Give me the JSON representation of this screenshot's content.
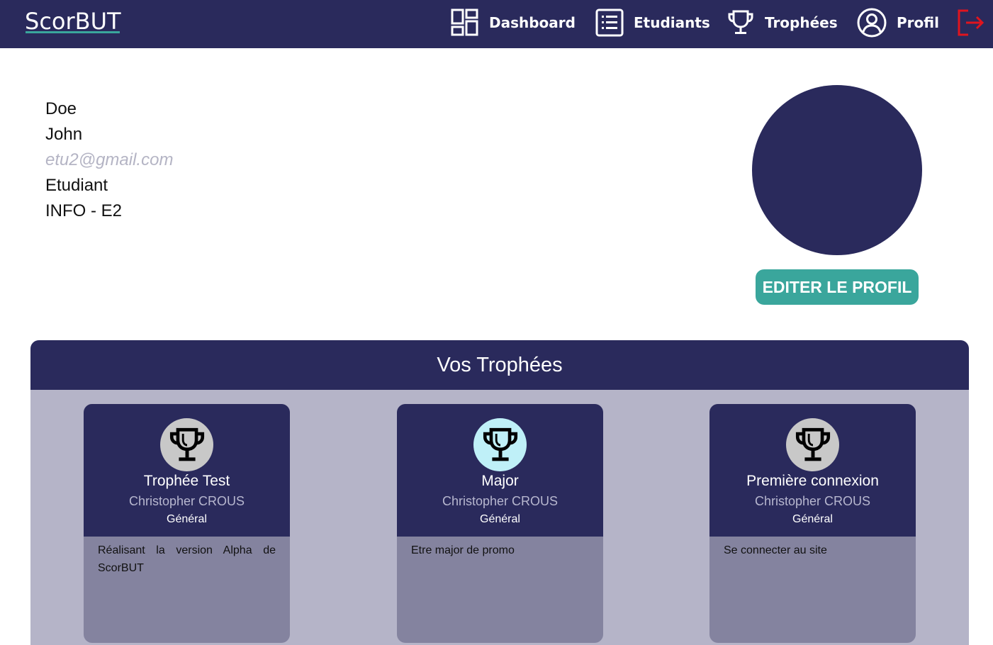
{
  "app": {
    "brand": "ScorBUT",
    "accent": "#3aa69c",
    "primary": "#2a2a5c",
    "logout_color": "#e0141e"
  },
  "nav": {
    "items": [
      {
        "label": "Dashboard",
        "icon": "grid-icon"
      },
      {
        "label": "Etudiants",
        "icon": "list-icon"
      },
      {
        "label": "Trophées",
        "icon": "trophy-icon"
      },
      {
        "label": "Profil",
        "icon": "user-circle-icon"
      }
    ],
    "logout_icon": "logout-icon"
  },
  "profile": {
    "last_name": "Doe",
    "first_name": "John",
    "email": "etu2@gmail.com",
    "role": "Etudiant",
    "group": "INFO - E2",
    "edit_label": "EDITER LE PROFIL"
  },
  "trophies": {
    "title": "Vos Trophées",
    "cards": [
      {
        "title": "Trophée Test",
        "author": "Christopher CROUS",
        "category": "Général",
        "description": "Réalisant la version Alpha de ScorBUT",
        "badge_color": "#c8c8c8"
      },
      {
        "title": "Major",
        "author": "Christopher CROUS",
        "category": "Général",
        "description": "Etre major de promo",
        "badge_color": "#bff0f8"
      },
      {
        "title": "Première connexion",
        "author": "Christopher CROUS",
        "category": "Général",
        "description": "Se connecter au site",
        "badge_color": "#c8c8c8"
      }
    ]
  }
}
